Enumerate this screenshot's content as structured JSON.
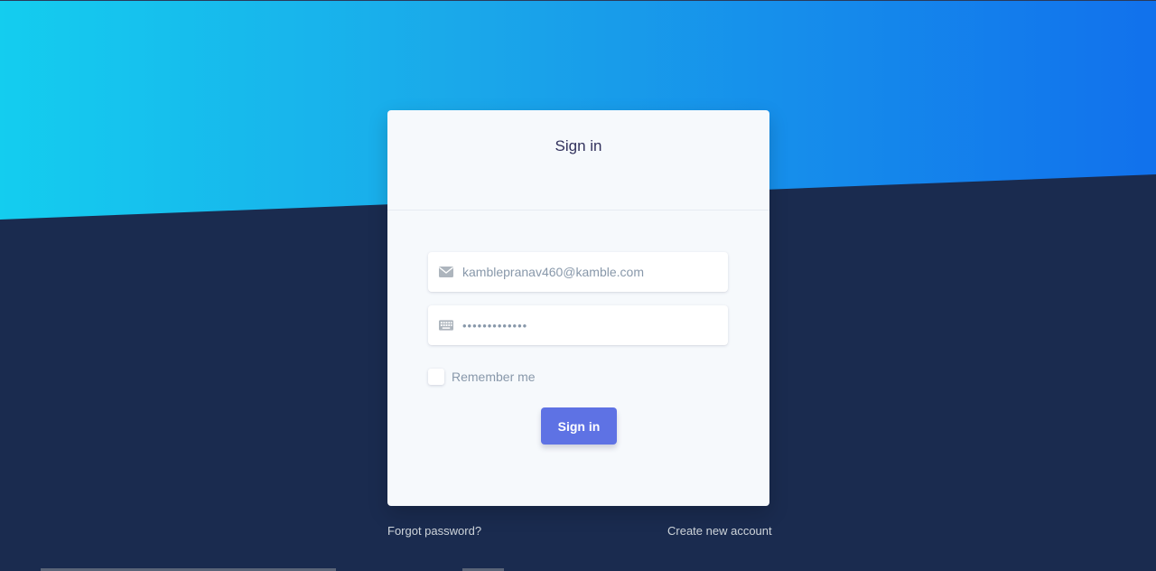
{
  "card": {
    "title": "Sign in"
  },
  "form": {
    "email_value": "kamblepranav460@kamble.com",
    "email_icon": "envelope-icon",
    "password_value": "•••••••••••••",
    "password_icon": "keyboard-icon",
    "remember_label": "Remember me",
    "remember_checked": false,
    "submit_label": "Sign in"
  },
  "links": {
    "forgot": "Forgot password?",
    "create": "Create new account"
  },
  "colors": {
    "background": "#1a2b4f",
    "gradient_start": "#14cdef",
    "gradient_end": "#1171ec",
    "primary_button": "#5e72e4",
    "card": "#f6f9fc"
  }
}
